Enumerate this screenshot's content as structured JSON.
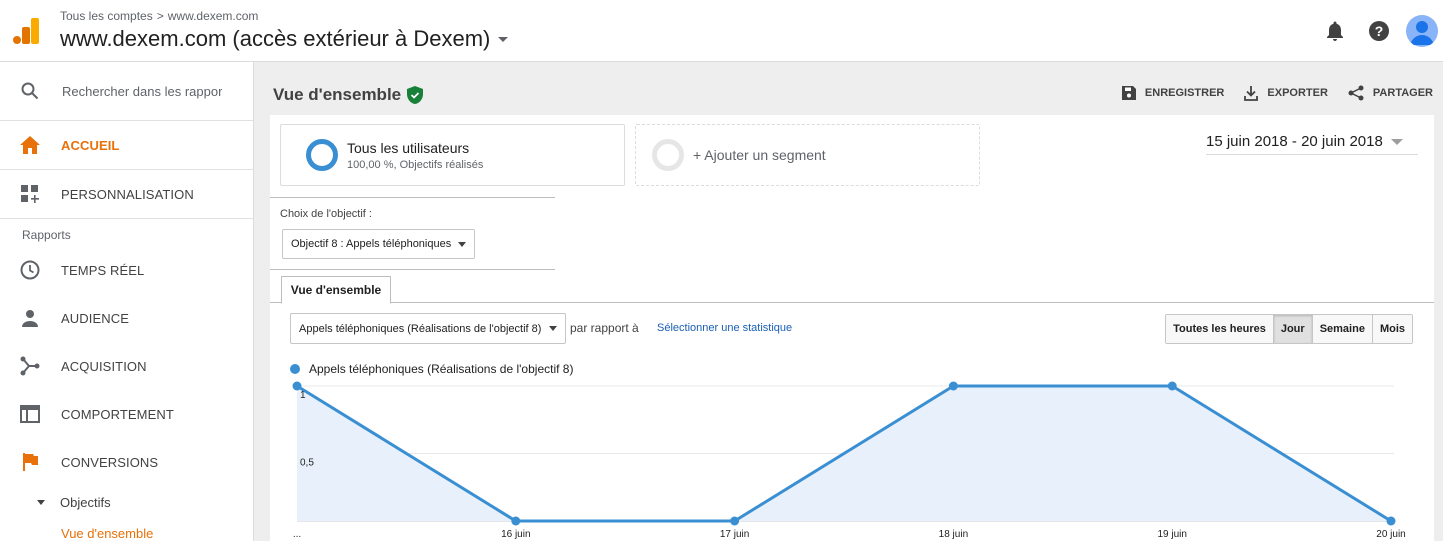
{
  "header": {
    "breadcrumb": [
      "Tous les comptes",
      "www.dexem.com"
    ],
    "breadcrumb_sep": ">",
    "property_title": "www.dexem.com (accès extérieur à Dexem)",
    "icons": [
      "notifications-icon",
      "help-icon",
      "account-avatar-icon"
    ]
  },
  "sidebar": {
    "search_placeholder": "Rechercher dans les rappor",
    "top_items": [
      {
        "label": "ACCUEIL",
        "icon": "home-icon",
        "active": true
      },
      {
        "label": "PERSONNALISATION",
        "icon": "dashboard-add-icon",
        "active": false
      }
    ],
    "section_label": "Rapports",
    "report_items": [
      {
        "label": "TEMPS RÉEL",
        "icon": "clock-icon"
      },
      {
        "label": "AUDIENCE",
        "icon": "person-icon"
      },
      {
        "label": "ACQUISITION",
        "icon": "acquisition-icon"
      },
      {
        "label": "COMPORTEMENT",
        "icon": "behavior-icon"
      },
      {
        "label": "CONVERSIONS",
        "icon": "flag-icon"
      }
    ],
    "sub_item": "Objectifs",
    "sub_sub_item": "Vue d'ensemble"
  },
  "main": {
    "title": "Vue d'ensemble",
    "actions": {
      "save": "ENREGISTRER",
      "export": "EXPORTER",
      "share": "PARTAGER"
    },
    "segment": {
      "title": "Tous les utilisateurs",
      "subtitle": "100,00 %, Objectifs réalisés"
    },
    "add_segment": "+ Ajouter un segment",
    "date_range": "15 juin 2018 - 20 juin 2018",
    "goal_label": "Choix de l'objectif :",
    "goal_value": "Objectif 8 : Appels téléphoniques",
    "tab": "Vue d'ensemble",
    "metric_value": "Appels téléphoniques (Réalisations de l'objectif 8)",
    "compare_label": "par rapport à",
    "select_stat": "Sélectionner une statistique",
    "granularity": [
      "Toutes les heures",
      "Jour",
      "Semaine",
      "Mois"
    ],
    "granularity_selected": "Jour",
    "accent": "#e8710a",
    "series_color": "#3a8fd3"
  },
  "chart_data": {
    "type": "area",
    "series": [
      {
        "name": "Appels téléphoniques (Réalisations de l'objectif 8)",
        "values": [
          1,
          0,
          0,
          1,
          1,
          0
        ]
      }
    ],
    "categories": [
      "...",
      "16 juin",
      "17 juin",
      "18 juin",
      "19 juin",
      "20 juin"
    ],
    "y_ticks": [
      "1",
      "0,5"
    ],
    "ylim": [
      0,
      1
    ]
  }
}
